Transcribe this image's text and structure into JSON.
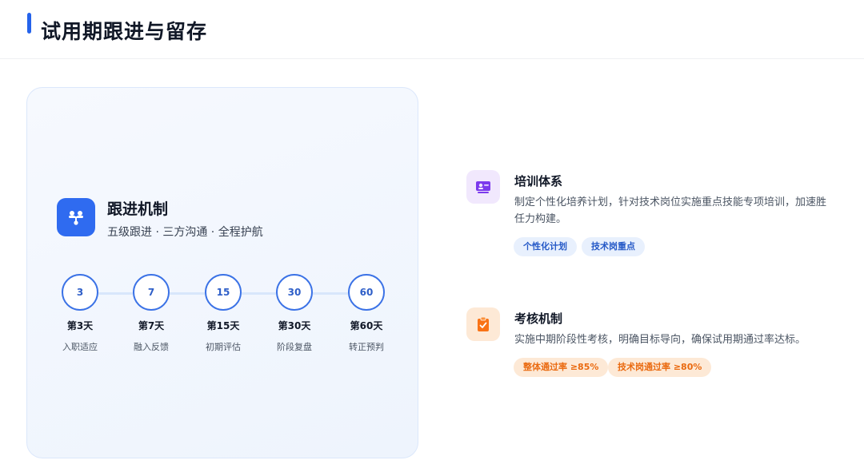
{
  "page": {
    "title": "试用期跟进与留存"
  },
  "mechanism": {
    "icon": "team-hierarchy-icon",
    "title": "跟进机制",
    "subtitle": "五级跟进 · 三方沟通 · 全程护航",
    "steps": [
      {
        "num": "3",
        "day": "第3天",
        "desc": "入职适应"
      },
      {
        "num": "7",
        "day": "第7天",
        "desc": "融入反馈"
      },
      {
        "num": "15",
        "day": "第15天",
        "desc": "初期评估"
      },
      {
        "num": "30",
        "day": "第30天",
        "desc": "阶段复盘"
      },
      {
        "num": "60",
        "day": "第60天",
        "desc": "转正预判"
      }
    ]
  },
  "training": {
    "icon": "training-board-icon",
    "title": "培训体系",
    "desc": "制定个性化培养计划，针对技术岗位实施重点技能专项培训，加速胜任力构建。",
    "tags": [
      "个性化计划",
      "技术岗重点"
    ]
  },
  "assessment": {
    "icon": "clipboard-check-icon",
    "title": "考核机制",
    "desc": "实施中期阶段性考核，明确目标导向，确保试用期通过率达标。",
    "tags": [
      "整体通过率 ≥85%",
      "技术岗通过率 ≥80%"
    ]
  },
  "colors": {
    "accent": "#2563eb",
    "training_icon_bg": "#f1e8fd",
    "training_icon": "#7c3aed",
    "assessment_icon_bg": "#fde9d6",
    "assessment_icon": "#f97316"
  }
}
